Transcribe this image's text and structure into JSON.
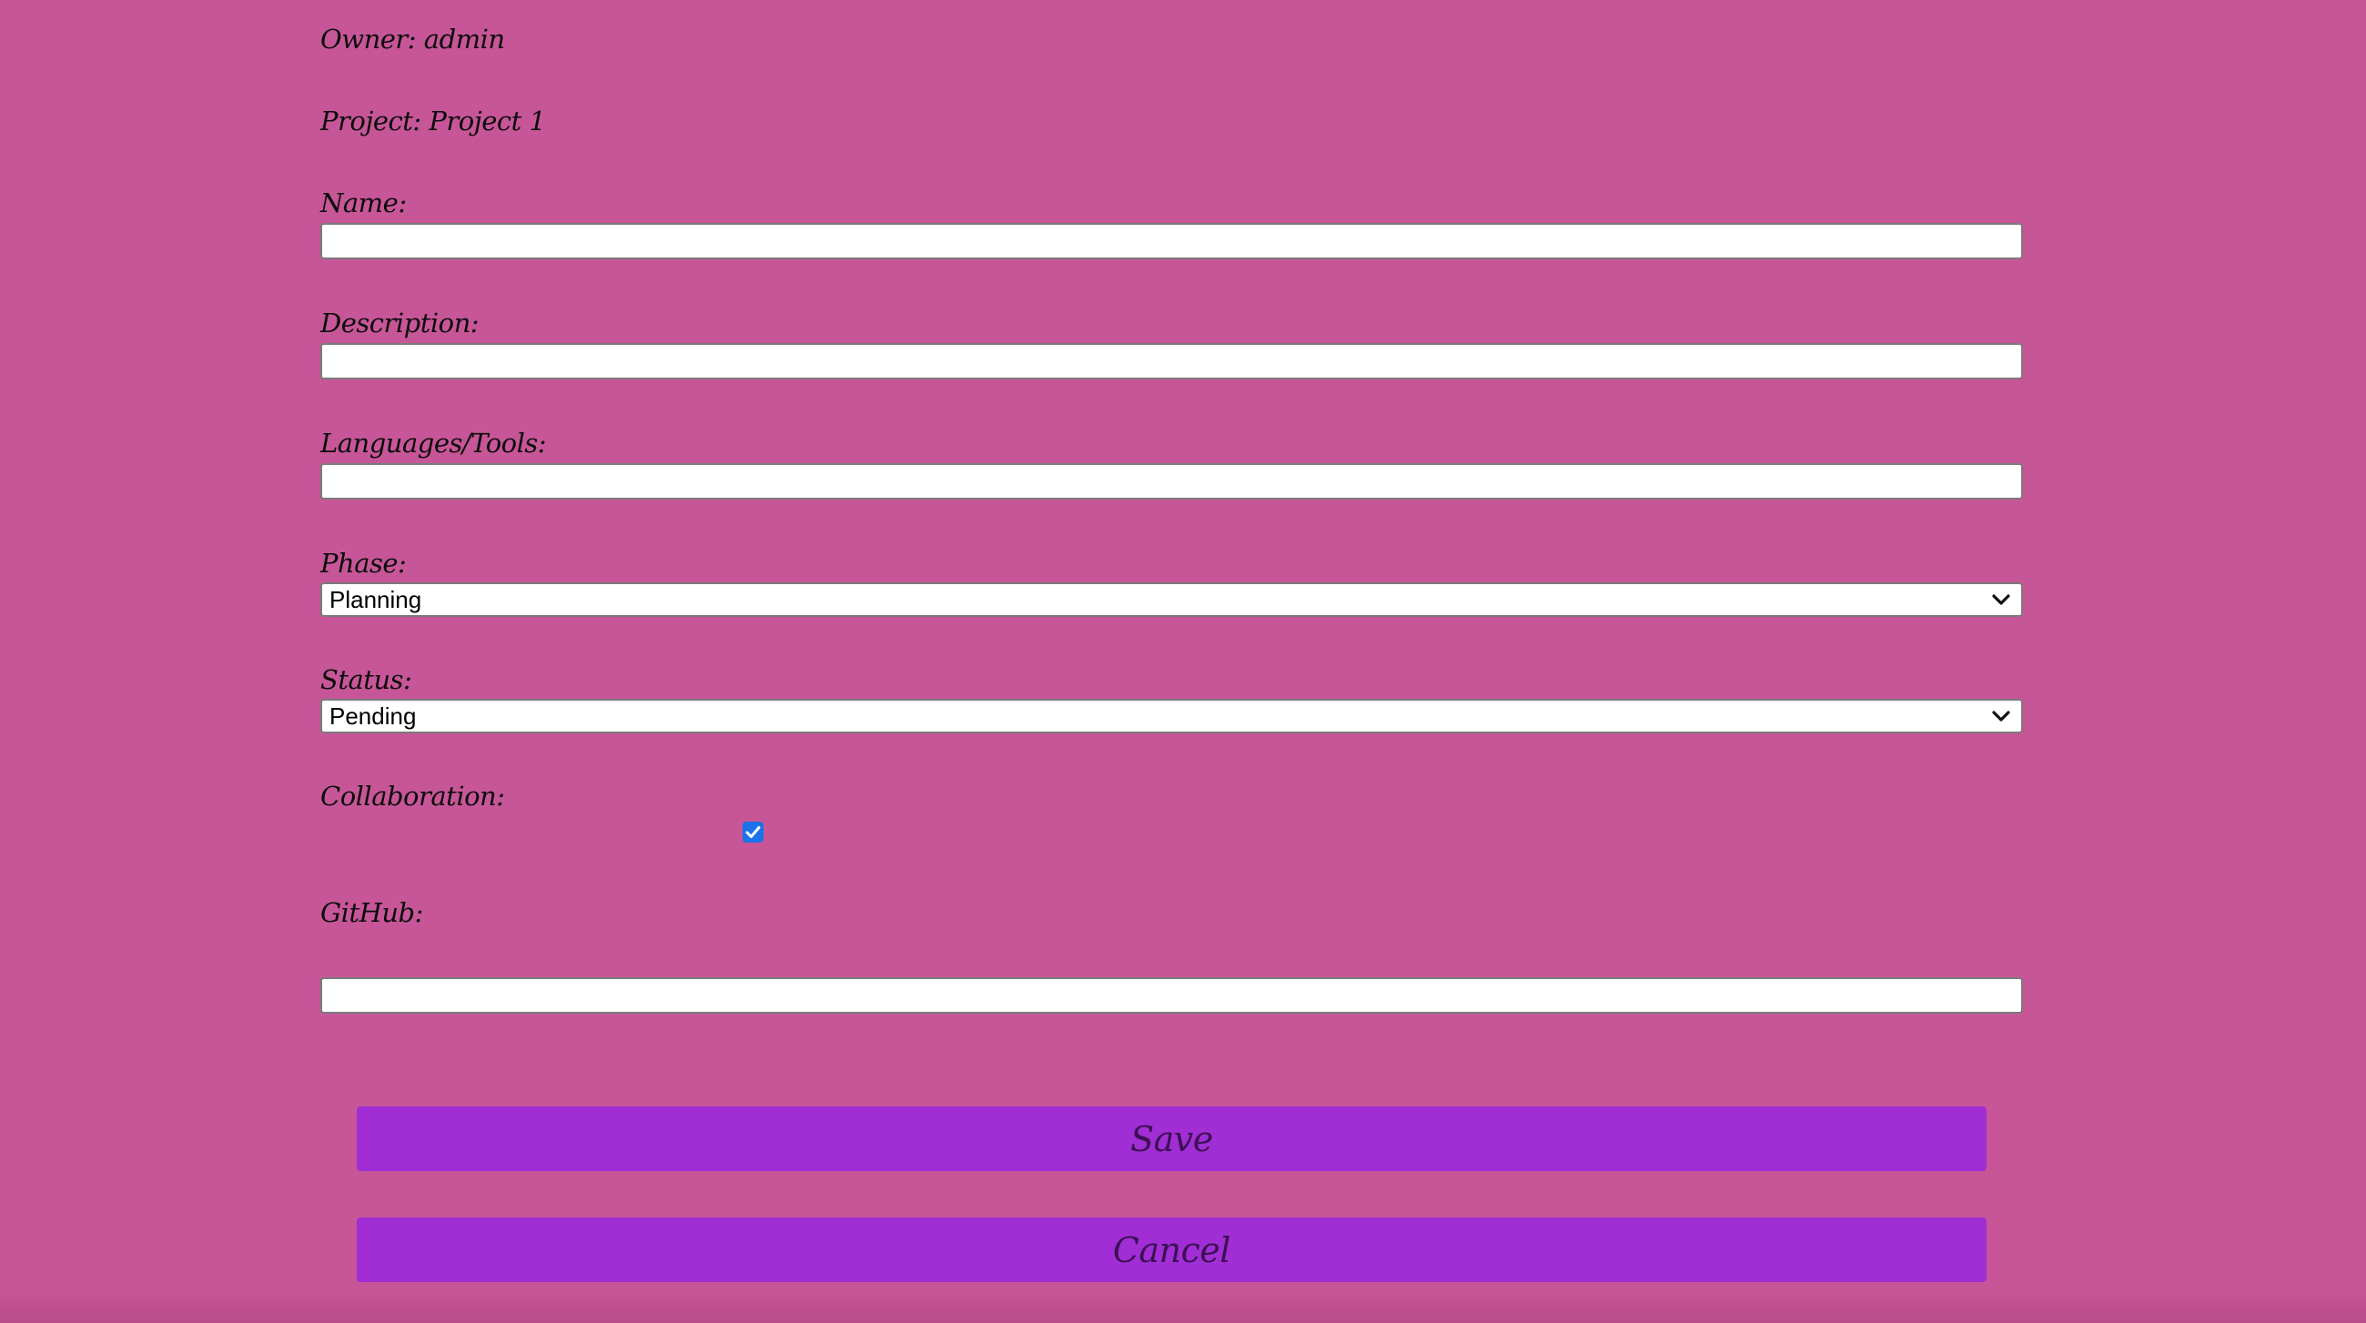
{
  "header": {
    "owner_label": "Owner: admin",
    "project_label": "Project: Project 1"
  },
  "form": {
    "name": {
      "label": "Name:",
      "value": "",
      "placeholder": ""
    },
    "description": {
      "label": "Description:",
      "value": "",
      "placeholder": ""
    },
    "languages": {
      "label": "Languages/Tools:",
      "value": "",
      "placeholder": ""
    },
    "phase": {
      "label": "Phase:",
      "selected": "Planning"
    },
    "status": {
      "label": "Status:",
      "selected": "Pending"
    },
    "collaboration": {
      "label": "Collaboration:",
      "checked": true
    },
    "github": {
      "label": "GitHub:",
      "value": "",
      "placeholder": ""
    }
  },
  "actions": {
    "save_label": "Save",
    "cancel_label": "Cancel"
  },
  "colors": {
    "background": "#c75698",
    "button": "#a02ed4",
    "button_text": "#3d0f55",
    "checkbox": "#1a73e8"
  },
  "icons": {
    "select_chevron": "chevron-down-icon",
    "checkbox_mark": "checkmark-icon"
  }
}
